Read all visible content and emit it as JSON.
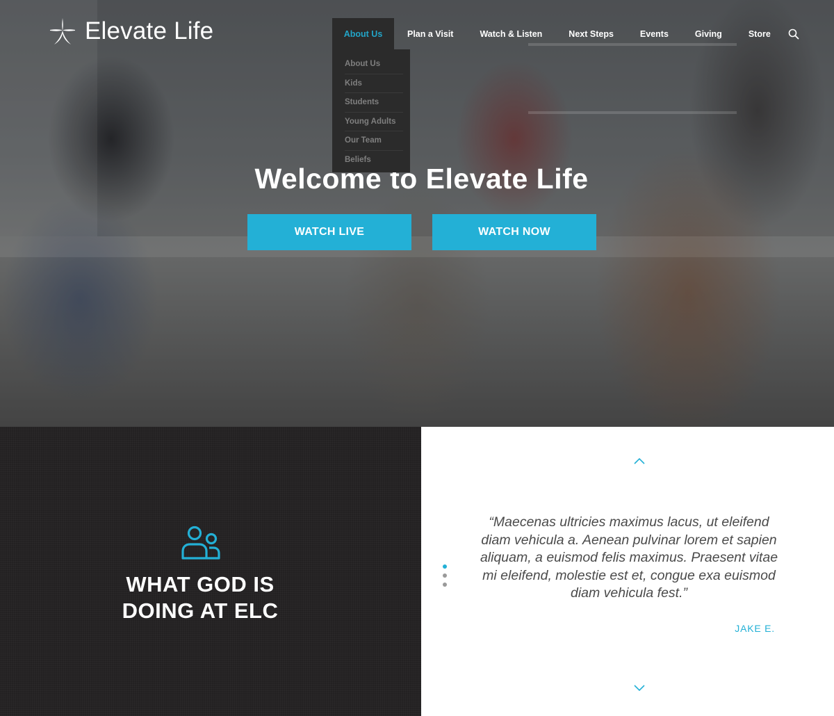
{
  "brand": {
    "name": "Elevate Life"
  },
  "nav": {
    "items": [
      "About Us",
      "Plan a Visit",
      "Watch & Listen",
      "Next Steps",
      "Events",
      "Giving",
      "Store"
    ],
    "active_index": 0,
    "search_icon": "search-icon"
  },
  "dropdown": {
    "items": [
      "About Us",
      "Kids",
      "Students",
      "Young Adults",
      "Our Team",
      "Beliefs"
    ]
  },
  "hero": {
    "title": "Welcome to Elevate Life",
    "watch_live": "WATCH LIVE",
    "watch_now": "WATCH NOW"
  },
  "section": {
    "icon": "people-icon",
    "title_line1": "WHAT GOD IS",
    "title_line2": "DOING AT ELC"
  },
  "testimonial": {
    "quote": "“Maecenas ultricies maximus lacus, ut eleifend diam vehicula a. Aenean pulvinar lorem et sapien aliquam, a euismod felis maximus. Praesent vitae mi eleifend, molestie est et, congue exa euismod diam vehicula fest.”",
    "author": "JAKE E.",
    "slide_count": 3,
    "active_slide": 0
  },
  "colors": {
    "accent": "#23b0d6",
    "dark_panel": "#232122",
    "nav_dropdown": "#2b2b2b"
  }
}
